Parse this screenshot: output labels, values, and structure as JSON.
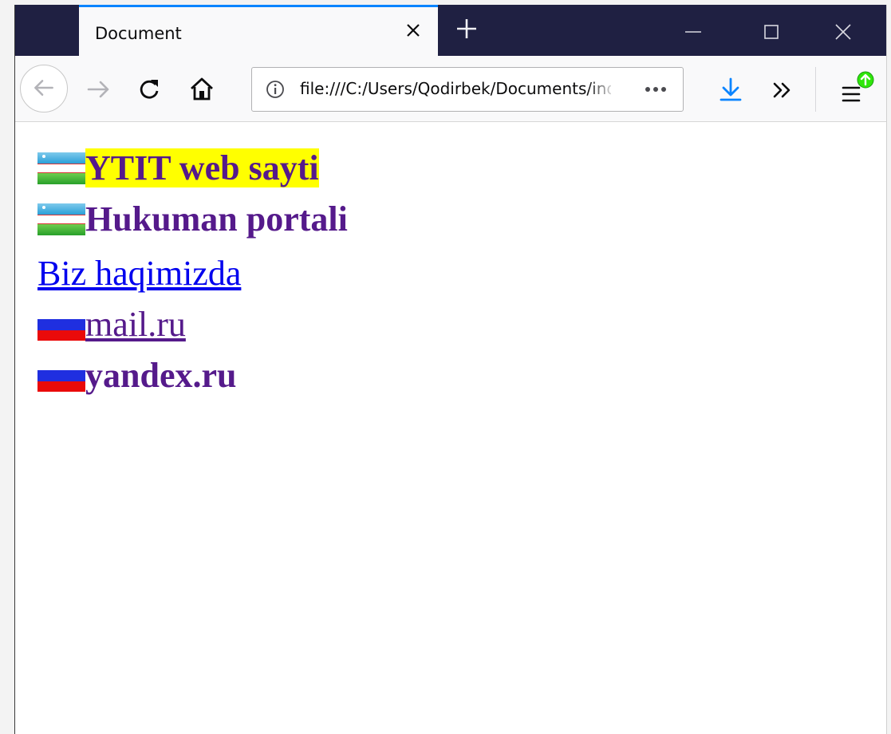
{
  "tab": {
    "title": "Document"
  },
  "urlbar": {
    "url": "file:///C:/Users/Qodirbek/Documents/index.html"
  },
  "content": {
    "links": [
      {
        "text": "YTIT web sayti",
        "flag": "uzbekistan-flag-icon",
        "highlighted": true,
        "bold": true,
        "color": "#551a8b"
      },
      {
        "text": "Hukuman portali",
        "flag": "uzbekistan-flag-icon",
        "highlighted": false,
        "bold": true,
        "color": "#551a8b"
      },
      {
        "text": "Biz haqimizda",
        "flag": null,
        "highlighted": false,
        "bold": false,
        "color": "#0000ee"
      },
      {
        "text": "mail.ru",
        "flag": "russia-flag-icon",
        "highlighted": false,
        "bold": false,
        "color": "#551a8b"
      },
      {
        "text": "yandex.ru",
        "flag": "russia-flag-icon",
        "highlighted": false,
        "bold": true,
        "color": "#551a8b"
      }
    ]
  },
  "colors": {
    "titlebar": "#1f2042",
    "tab_accent": "#0a84ff",
    "highlight": "#ffff00",
    "visited_link": "#551a8b",
    "unvisited_link": "#0000ee"
  }
}
